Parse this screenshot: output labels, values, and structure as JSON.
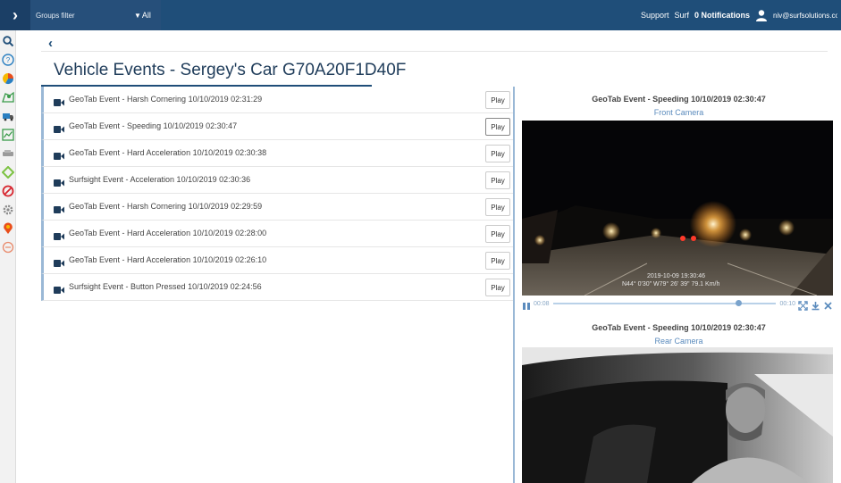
{
  "topbar": {
    "groups_filter_label": "Groups filter",
    "groups_value": "All",
    "support": "Support",
    "surf": "Surf",
    "notifications": "0 Notifications",
    "email": "niv@surfsolutions.co"
  },
  "sidebar": {
    "icons": [
      "search-icon",
      "help-icon",
      "pie-chart-icon",
      "map-icon",
      "truck-icon",
      "line-chart-icon",
      "vehicle-icon",
      "zone-icon",
      "blocked-icon",
      "settings-icon",
      "pin-icon",
      "circle-icon"
    ]
  },
  "page": {
    "title": "Vehicle Events - Sergey's Car G70A20F1D40F"
  },
  "events": [
    {
      "label": "GeoTab Event - Harsh Cornering 10/10/2019 02:31:29",
      "play": "Play"
    },
    {
      "label": "GeoTab Event - Speeding 10/10/2019 02:30:47",
      "play": "Play"
    },
    {
      "label": "GeoTab Event - Hard Acceleration 10/10/2019 02:30:38",
      "play": "Play"
    },
    {
      "label": "Surfsight Event - Acceleration 10/10/2019 02:30:36",
      "play": "Play"
    },
    {
      "label": "GeoTab Event - Harsh Cornering 10/10/2019 02:29:59",
      "play": "Play"
    },
    {
      "label": "GeoTab Event - Hard Acceleration 10/10/2019 02:28:00",
      "play": "Play"
    },
    {
      "label": "GeoTab Event - Hard Acceleration 10/10/2019 02:26:10",
      "play": "Play"
    },
    {
      "label": "Surfsight Event - Button Pressed 10/10/2019 02:24:56",
      "play": "Play"
    }
  ],
  "viewer": {
    "front": {
      "title": "GeoTab Event - Speeding 10/10/2019 02:30:47",
      "camera": "Front Camera",
      "overlay_line1": "2019-10-09 19:30:46",
      "overlay_line2": "N44° 0'30\" W79° 26' 39\" 79.1 Km/h",
      "time_start": "00:08",
      "time_end": "00:10",
      "progress": 0.82
    },
    "rear": {
      "title": "GeoTab Event - Speeding 10/10/2019 02:30:47",
      "camera": "Rear Camera"
    }
  },
  "colors": {
    "topbar": "#1f4e79",
    "accent": "#9ab8d6",
    "link": "#5b8bbd"
  }
}
